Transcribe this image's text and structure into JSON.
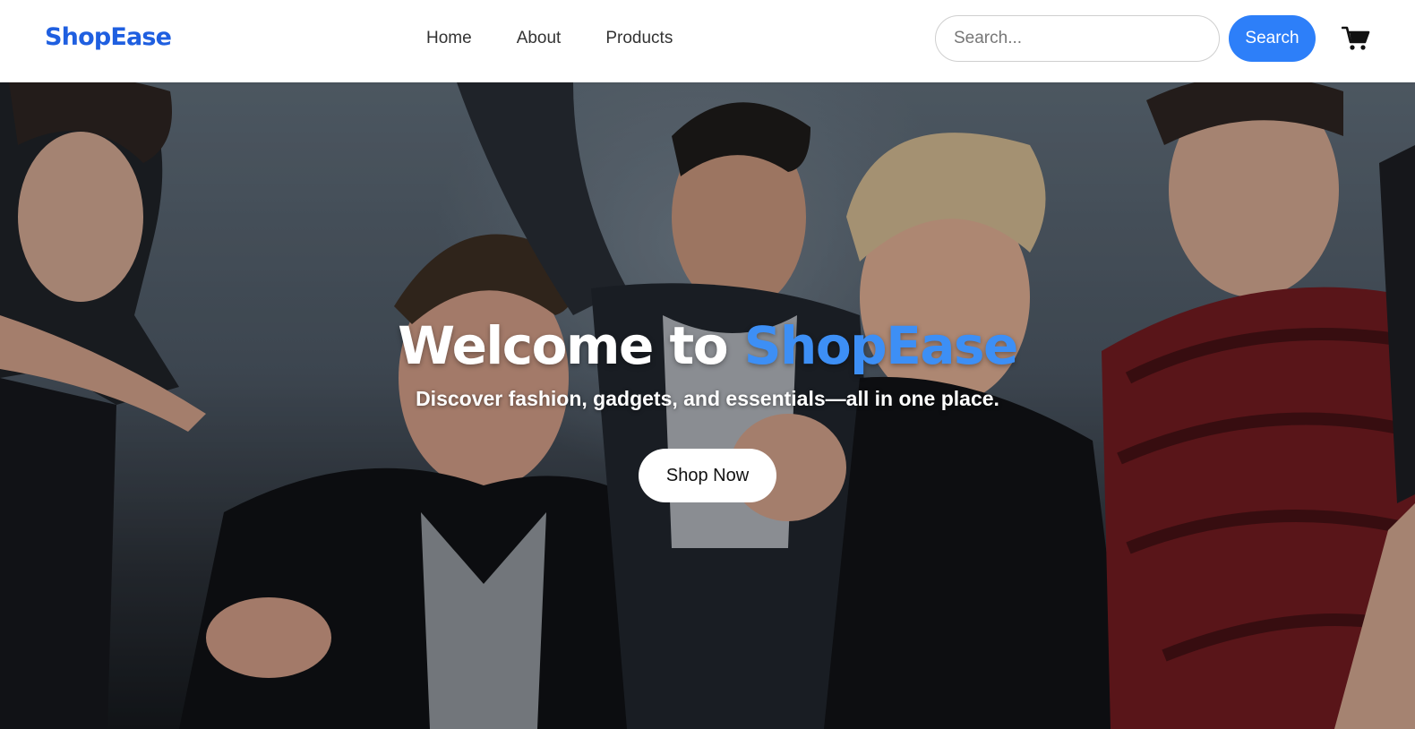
{
  "header": {
    "logo": "ShopEase",
    "nav": [
      {
        "label": "Home"
      },
      {
        "label": "About"
      },
      {
        "label": "Products"
      }
    ],
    "search": {
      "placeholder": "Search...",
      "value": ""
    },
    "search_button_label": "Search",
    "cart_icon": "shopping-cart-icon"
  },
  "hero": {
    "title_prefix": "Welcome to ",
    "title_brand": "ShopEase",
    "subtitle": "Discover fashion, gadgets, and essentials—all in one place.",
    "cta_label": "Shop Now",
    "image": "group-photo-five-young-men"
  },
  "colors": {
    "brand_blue": "#1f5fe0",
    "button_blue": "#2d7ff9",
    "hero_brand_blue": "#3d8ff5"
  }
}
